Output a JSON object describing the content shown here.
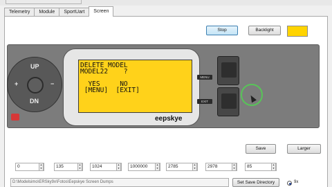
{
  "tabs": [
    {
      "label": "Telemetry"
    },
    {
      "label": "Module"
    },
    {
      "label": "SportUart"
    },
    {
      "label": "Screen"
    }
  ],
  "controls": {
    "stop_label": "Stop",
    "backlight_label": "Backlight",
    "backlight_color": "#ffd400",
    "save_label": "Save",
    "larger_label": "Larger",
    "set_save_dir_label": "Set Save Directory"
  },
  "lcd": {
    "lines": [
      "DELETE MODEL",
      "MODEL22    ?",
      "",
      "  YES     NO",
      " [MENU]  [EXIT]"
    ],
    "background": "#ffd21a"
  },
  "radio": {
    "brand": "eepskye",
    "dpad": {
      "up": "UP",
      "left": "+",
      "right": "−",
      "down": "DN"
    },
    "menu_label": "MENU",
    "exit_label": "EXIT"
  },
  "fields": [
    {
      "value": "0"
    },
    {
      "value": "135"
    },
    {
      "value": "1024"
    },
    {
      "value": "1000000"
    },
    {
      "value": "2785"
    },
    {
      "value": "2978"
    },
    {
      "value": "85"
    }
  ],
  "save_path": "D:\\Modelsimo\\ERSky9x\\Fotos\\Eepskye Screen Dumps",
  "option_label": "9x"
}
